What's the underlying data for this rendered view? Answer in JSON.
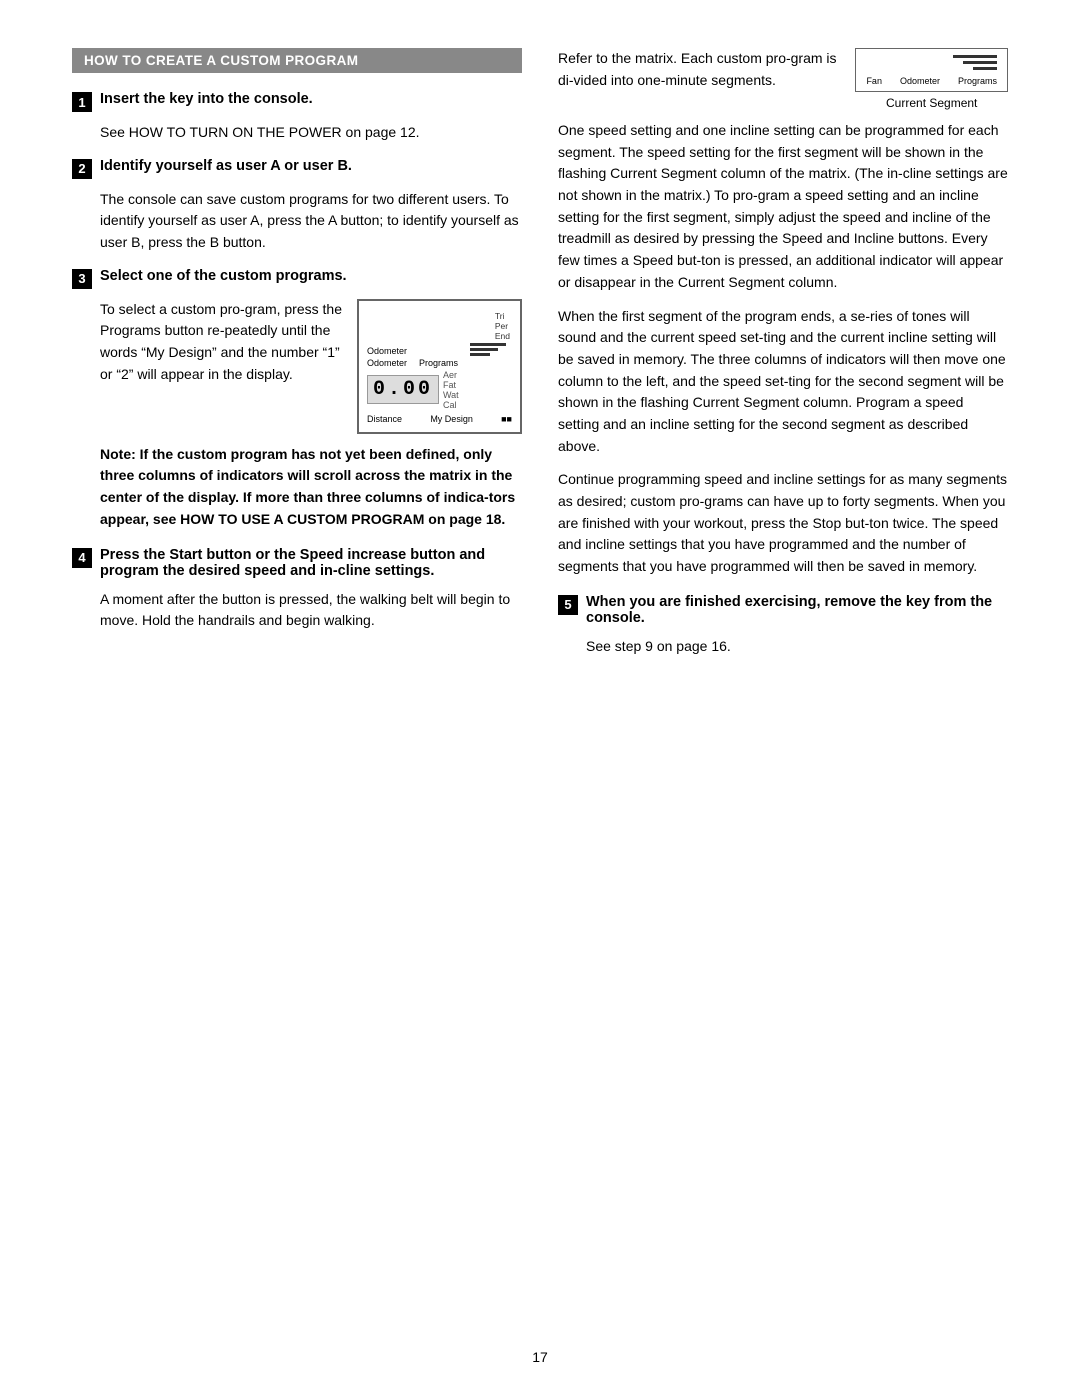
{
  "page": {
    "number": "17",
    "section_header": "HOW TO CREATE A CUSTOM PROGRAM",
    "steps": [
      {
        "num": "1",
        "title": "Insert the key into the console.",
        "body": "See HOW TO TURN ON THE POWER on page 12."
      },
      {
        "num": "2",
        "title": "Identify yourself as user A or user B.",
        "body": "The console can save custom programs for two different users. To identify yourself as user A, press the A button; to identify yourself as user B, press the B button."
      },
      {
        "num": "3",
        "title": "Select one of the custom programs.",
        "body_before": "To select a custom pro-gram, press the Programs button re-peatedly until the words “My Design” and the number “1” or “2” will appear in the display.",
        "console_labels": {
          "label1": "Odometer",
          "label2": "Programs",
          "label3": "Distance",
          "label4": "My Design"
        },
        "note": "Note: If the custom program has not yet been defined, only three columns of indicators will scroll across the matrix in the center of the display. If more than three columns of indica-tors appear, see HOW TO USE A CUSTOM PROGRAM on page 18."
      },
      {
        "num": "4",
        "title": "Press the Start button or the Speed increase button and program the desired speed and in-cline settings.",
        "body1": "A moment after the button is pressed, the walking belt will begin to move. Hold the handrails and begin walking."
      }
    ],
    "right_col": {
      "intro": "Refer to the matrix. Each custom pro-gram is di-vided into one-minute segments.",
      "diagram_labels": {
        "fan": "Fan",
        "odometer": "Odometer",
        "programs": "Programs",
        "current_segment": "Current Segment"
      },
      "para1": "One speed setting and one incline setting can be programmed for each segment. The speed setting for the first segment will be shown in the flashing Current Segment column of the matrix. (The in-cline settings are not shown in the matrix.) To pro-gram a speed setting and an incline setting for the first segment, simply adjust the speed and incline of the treadmill as desired by pressing the Speed and Incline buttons. Every few times a Speed but-ton is pressed, an additional indicator will appear or disappear in the Current Segment column.",
      "para2": "When the first segment of the program ends, a se-ries of tones will sound and the current speed set-ting and the current incline setting will be saved in memory. The three columns of indicators will then move one column to the left, and the speed set-ting for the second segment will be shown in the flashing Current Segment column. Program a speed setting and an incline setting for the second segment as described above.",
      "para3": "Continue programming speed and incline settings for as many segments as desired; custom pro-grams can have up to forty segments. When you are finished with your workout, press the Stop but-ton twice. The speed and incline settings that you have programmed and the number of segments that you have programmed will then be saved in memory.",
      "step5": {
        "num": "5",
        "title": "When you are finished exercising, remove the key from the console.",
        "body": "See step 9 on page 16."
      }
    }
  }
}
